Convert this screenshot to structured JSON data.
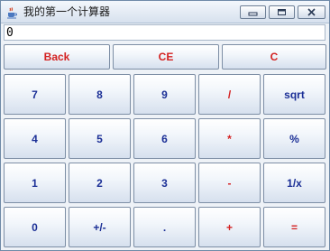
{
  "window": {
    "title": "我的第一个计算器"
  },
  "titlebar_buttons": {
    "minimize_icon": "minimize-icon",
    "maximize_icon": "maximize-icon",
    "close_icon": "close-icon"
  },
  "display": {
    "value": "0"
  },
  "top_row": [
    {
      "label": "Back",
      "color": "#d42222"
    },
    {
      "label": "CE",
      "color": "#d42222"
    },
    {
      "label": "C",
      "color": "#d42222"
    }
  ],
  "keypad": [
    [
      {
        "label": "7",
        "color": "#1b2f96"
      },
      {
        "label": "8",
        "color": "#1b2f96"
      },
      {
        "label": "9",
        "color": "#1b2f96"
      },
      {
        "label": "/",
        "color": "#d42222"
      },
      {
        "label": "sqrt",
        "color": "#1b2f96"
      }
    ],
    [
      {
        "label": "4",
        "color": "#1b2f96"
      },
      {
        "label": "5",
        "color": "#1b2f96"
      },
      {
        "label": "6",
        "color": "#1b2f96"
      },
      {
        "label": "*",
        "color": "#d42222"
      },
      {
        "label": "%",
        "color": "#1b2f96"
      }
    ],
    [
      {
        "label": "1",
        "color": "#1b2f96"
      },
      {
        "label": "2",
        "color": "#1b2f96"
      },
      {
        "label": "3",
        "color": "#1b2f96"
      },
      {
        "label": "-",
        "color": "#d42222"
      },
      {
        "label": "1/x",
        "color": "#1b2f96"
      }
    ],
    [
      {
        "label": "0",
        "color": "#1b2f96"
      },
      {
        "label": "+/-",
        "color": "#1b2f96"
      },
      {
        "label": ".",
        "color": "#1b2f96"
      },
      {
        "label": "+",
        "color": "#d42222"
      },
      {
        "label": "=",
        "color": "#d42222"
      }
    ]
  ]
}
